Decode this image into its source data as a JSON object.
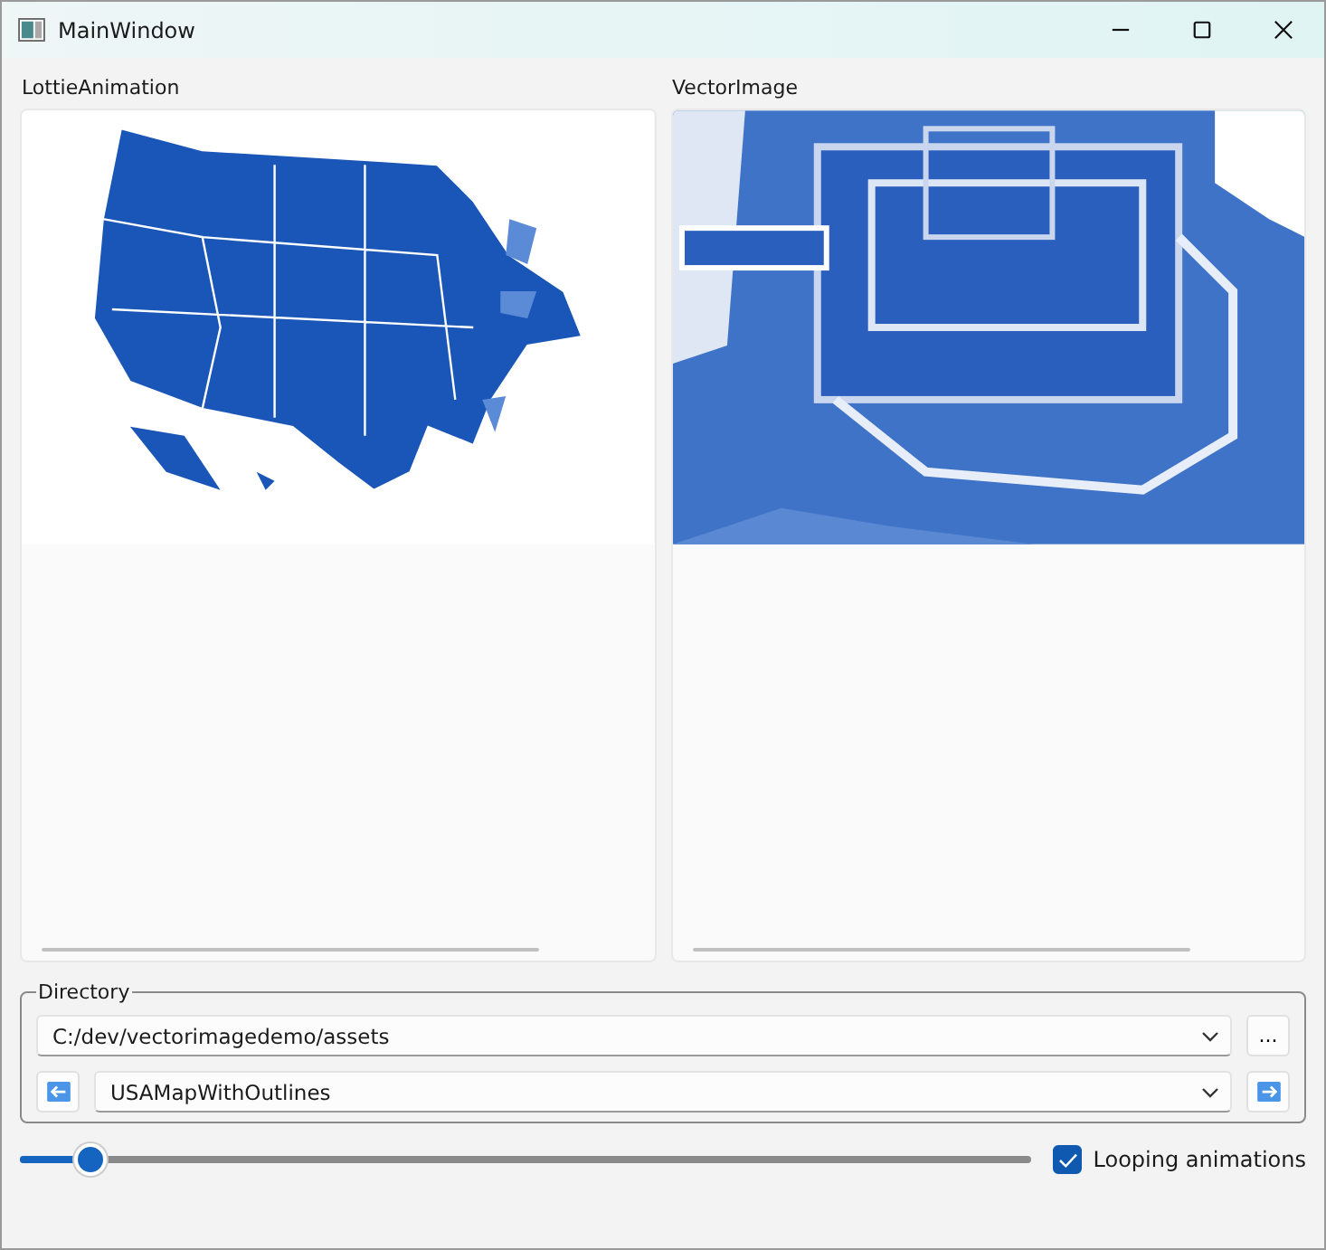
{
  "window": {
    "title": "MainWindow"
  },
  "panels": [
    {
      "title": "LottieAnimation",
      "kind": "lottie"
    },
    {
      "title": "VectorImage",
      "kind": "vector"
    }
  ],
  "directory": {
    "title": "Directory",
    "path": "C:/dev/vectorimagedemo/assets",
    "browse": "...",
    "file": "USAMapWithOutlines"
  },
  "slider": {
    "level": 0.07
  },
  "looping": {
    "label": "Looping animations",
    "checked": true
  }
}
